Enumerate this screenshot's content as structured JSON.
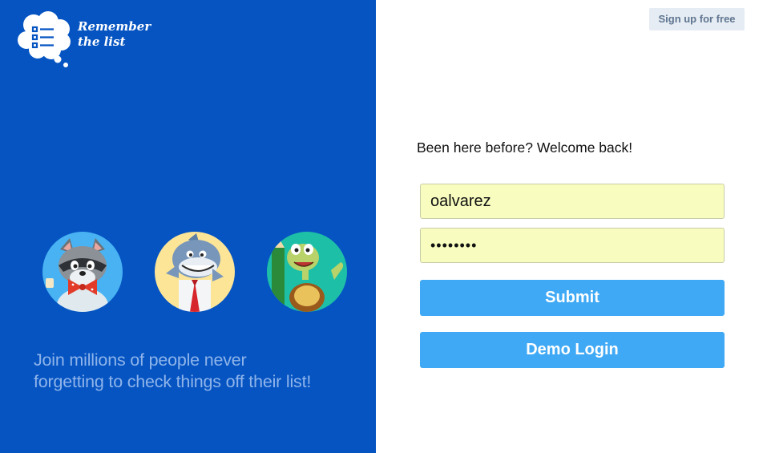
{
  "brand": {
    "name_line1": "Remember",
    "name_line2": "the list",
    "logo_icon": "thought-cloud-list-icon"
  },
  "colors": {
    "panel_blue": "#0554c2",
    "button_blue": "#3fa9f5",
    "input_fill": "#f8fdbf",
    "tagline": "#8fb4ea"
  },
  "header": {
    "signup_label": "Sign up for free"
  },
  "hero": {
    "avatars": [
      "raccoon-avatar",
      "shark-avatar",
      "turtle-avatar"
    ],
    "tagline_line1": "Join millions of people never",
    "tagline_line2": "forgetting to check things off their list!"
  },
  "login": {
    "welcome": "Been here before? Welcome back!",
    "username_value": "oalvarez",
    "password_value": "••••••••",
    "submit_label": "Submit",
    "demo_label": "Demo Login"
  }
}
